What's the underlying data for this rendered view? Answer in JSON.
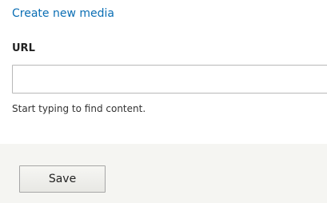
{
  "links": {
    "create_media": "Create new media"
  },
  "url_field": {
    "label": "URL",
    "value": "",
    "placeholder": "",
    "help_text": "Start typing to find content."
  },
  "actions": {
    "save_label": "Save"
  }
}
